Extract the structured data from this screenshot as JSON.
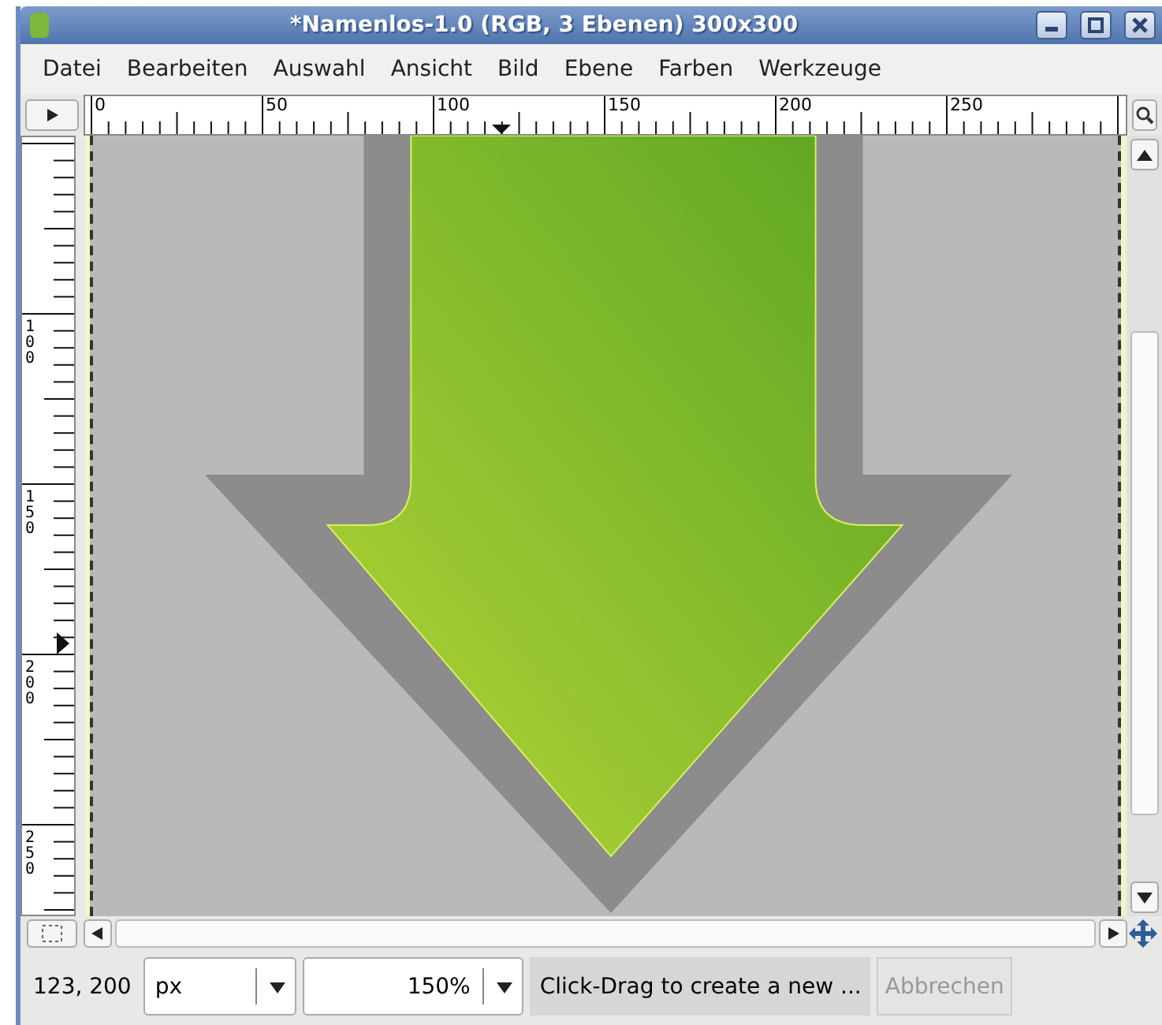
{
  "window": {
    "title": "*Namenlos-1.0 (RGB, 3 Ebenen) 300x300"
  },
  "menu": [
    "Datei",
    "Bearbeiten",
    "Auswahl",
    "Ansicht",
    "Bild",
    "Ebene",
    "Farben",
    "Werkzeuge"
  ],
  "rulers": {
    "horizontal": [
      "0",
      "50",
      "100",
      "150",
      "200",
      "250"
    ],
    "vertical": [
      "100",
      "150",
      "200",
      "250"
    ]
  },
  "status_bar": {
    "coordinates": "123, 200",
    "unit": "px",
    "zoom": "150%",
    "message": "Click-Drag to create a new ...",
    "cancel": {
      "label": "Abbrechen",
      "disabled": true
    }
  }
}
